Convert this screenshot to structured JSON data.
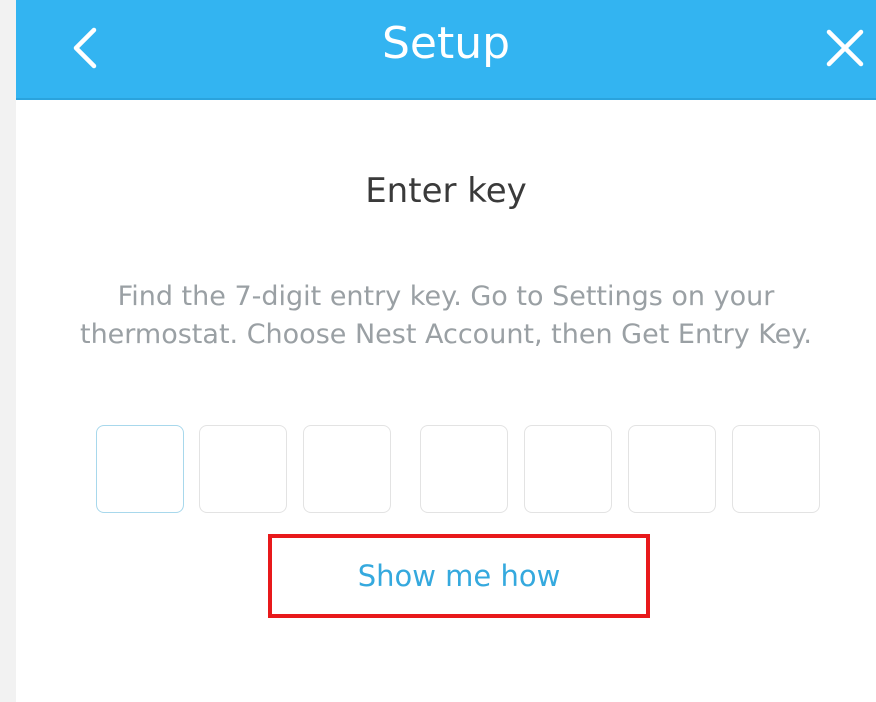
{
  "header": {
    "title": "Setup",
    "back_icon": "chevron-left-icon",
    "close_icon": "close-icon",
    "background_color": "#33b4f1"
  },
  "main": {
    "heading": "Enter key",
    "instructions": "Find the 7-digit entry key. Go to Settings on your\nthermostat. Choose Nest Account, then Get Entry Key.",
    "entry_key_digits": [
      "",
      "",
      "",
      "",
      "",
      "",
      ""
    ],
    "show_me_how_label": "Show me how",
    "link_color": "#35a9de",
    "highlight_color": "#e8191b"
  }
}
